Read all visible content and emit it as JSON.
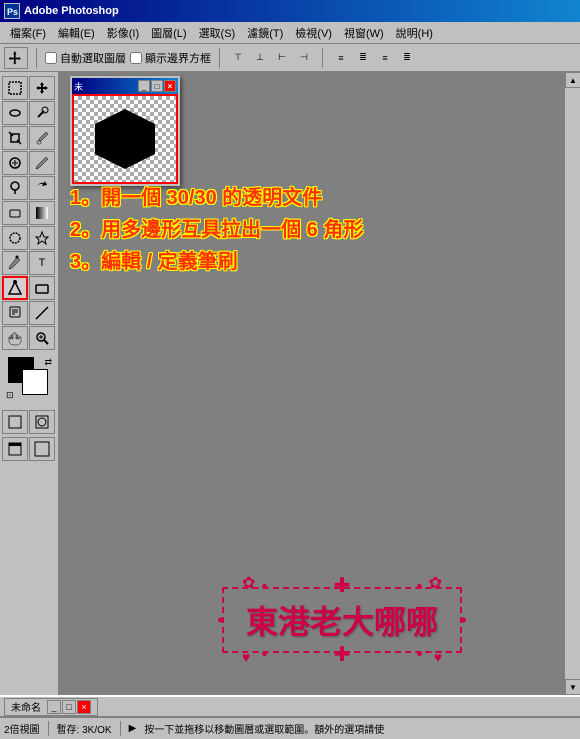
{
  "titlebar": {
    "title": "Adobe Photoshop",
    "icon_label": "PS"
  },
  "menubar": {
    "items": [
      {
        "label": "檔案(F)"
      },
      {
        "label": "編輯(E)"
      },
      {
        "label": "影像(I)"
      },
      {
        "label": "圖層(L)"
      },
      {
        "label": "選取(S)"
      },
      {
        "label": "濾鏡(T)"
      },
      {
        "label": "檢視(V)"
      },
      {
        "label": "視窗(W)"
      },
      {
        "label": "說明(H)"
      }
    ]
  },
  "toolbar": {
    "arrow_icon": "↖",
    "auto_select_label": "自動選取圖層",
    "show_bounds_label": "顯示邊界方框",
    "align_icons": [
      "⬌",
      "⬍",
      "↕",
      "↔"
    ],
    "distribute_icons": [
      "⬌",
      "⬍",
      "↕"
    ],
    "sep": "|"
  },
  "toolbox": {
    "tools": [
      {
        "icon": "↖",
        "name": "move-tool",
        "active": false
      },
      {
        "icon": "⬚",
        "name": "marquee-tool",
        "active": false
      },
      {
        "icon": "✂",
        "name": "lasso-tool",
        "active": false
      },
      {
        "icon": "🪄",
        "name": "magic-wand-tool",
        "active": false
      },
      {
        "icon": "✂",
        "name": "crop-tool",
        "active": false
      },
      {
        "icon": "⊘",
        "name": "slice-tool",
        "active": false
      },
      {
        "icon": "⚕",
        "name": "healing-brush-tool",
        "active": false
      },
      {
        "icon": "✏",
        "name": "brush-tool",
        "active": false
      },
      {
        "icon": "S",
        "name": "clone-stamp-tool",
        "active": false
      },
      {
        "icon": "⟳",
        "name": "history-brush-tool",
        "active": false
      },
      {
        "icon": "⬜",
        "name": "eraser-tool",
        "active": false
      },
      {
        "icon": "▦",
        "name": "gradient-tool",
        "active": false
      },
      {
        "icon": "○",
        "name": "blur-tool",
        "active": false
      },
      {
        "icon": "△",
        "name": "dodge-tool",
        "active": false
      },
      {
        "icon": "✒",
        "name": "pen-tool",
        "active": false
      },
      {
        "icon": "T",
        "name": "type-tool",
        "active": false
      },
      {
        "icon": "◻",
        "name": "shape-tool",
        "active": true
      },
      {
        "icon": "☞",
        "name": "path-selection-tool",
        "active": false
      },
      {
        "icon": "⬚",
        "name": "notes-tool",
        "active": false
      },
      {
        "icon": "✋",
        "name": "hand-tool",
        "active": false
      },
      {
        "icon": "🔍",
        "name": "zoom-tool",
        "active": false
      }
    ],
    "color_fg": "#000000",
    "color_bg": "#ffffff"
  },
  "mini_doc": {
    "title": "未",
    "hexagon_color": "#000000",
    "border_color": "#ff0000"
  },
  "instructions": {
    "line1": "1。開一個 30/30 的透明文件",
    "line2": "2。用多邊形互具拉出一個 6 角形",
    "line3": "3。編輯 / 定義筆刷"
  },
  "banner": {
    "text": "東港老大哪哪",
    "color": "#cc0044"
  },
  "taskbar": {
    "item_label": "未命名",
    "ctrl_minimize": "_",
    "ctrl_maximize": "□",
    "ctrl_close": "×"
  },
  "statusbar": {
    "zoom": "2倍視圖",
    "doc_info": "暫存: 3K/OK",
    "message": "按一下並拖移以移動圖層或選取範圍。額外的選項請使",
    "arrow": "▶"
  }
}
